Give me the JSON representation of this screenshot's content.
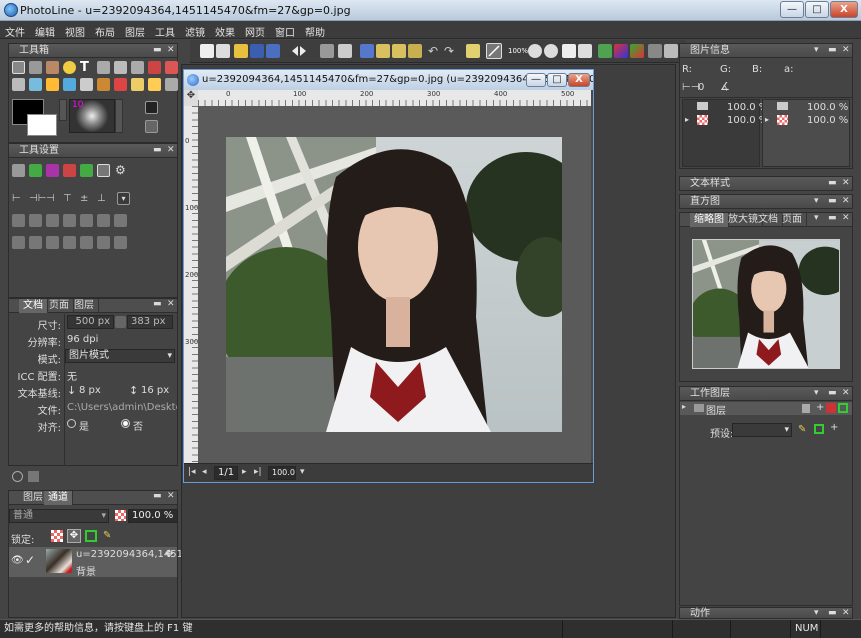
{
  "window": {
    "title": "PhotoLine - u=2392094364,1451145470&fm=27&gp=0.jpg",
    "minimize_label": "—",
    "maximize_label": "□",
    "close_label": "X"
  },
  "menu": [
    "文件",
    "编辑",
    "视图",
    "布局",
    "图层",
    "工具",
    "滤镜",
    "效果",
    "网页",
    "窗口",
    "帮助"
  ],
  "toolbar": {
    "zoom_label": "100%"
  },
  "toolbox": {
    "title": "工具箱",
    "brush_size": "10"
  },
  "tool_settings": {
    "title": "工具设置"
  },
  "doc_panel": {
    "tabs": [
      "文档",
      "页面",
      "图层"
    ],
    "size_label": "尺寸:",
    "size_w": "500 px",
    "size_h": "383 px",
    "resolution_label": "分辨率:",
    "resolution_value": "96 dpi",
    "mode_label": "模式:",
    "mode_value": "图片模式",
    "icc_label": "ICC 配置:",
    "icc_value": "无",
    "baseline_label": "文本基线:",
    "baseline_a": "8 px",
    "baseline_b": "16 px",
    "file_label": "文件:",
    "file_value": "C:\\Users\\admin\\Desktop\\dow",
    "align_label": "对齐:",
    "align_yes": "是",
    "align_no": "否"
  },
  "layers_panel": {
    "tabs": [
      "图层",
      "通道"
    ],
    "blend_mode": "普通",
    "opacity": "100.0 %",
    "lock_label": "锁定:",
    "layer_name": "u=2392094364,1451...",
    "layer_sub": "背景"
  },
  "document_window": {
    "title": "u=2392094364,1451145470&fm=27&gp=0.jpg (u=2392094364,1451145470&fm...",
    "page_field": "1/1",
    "zoom_field": "100.0 %",
    "ruler_h": [
      "0",
      "100",
      "200",
      "300",
      "400",
      "500"
    ],
    "ruler_v": [
      "0",
      "100",
      "200",
      "300"
    ]
  },
  "image_info": {
    "title": "图片信息",
    "channels": [
      "R:",
      "G:",
      "B:",
      "a:"
    ],
    "coord_value": "0",
    "rows": [
      {
        "left": "100.0 %",
        "right": "100.0 %"
      },
      {
        "left": "100.0 %",
        "right": "100.0 %"
      }
    ]
  },
  "text_style": {
    "title": "文本样式"
  },
  "histogram": {
    "title": "直方图"
  },
  "navigator": {
    "tabs": [
      "缩略图",
      "放大镜",
      "文档",
      "页面"
    ]
  },
  "work_layers": {
    "title": "工作图层",
    "layer_label": "图层",
    "preset_label": "预设:"
  },
  "actions": {
    "title": "动作"
  },
  "status": {
    "help_text": "如需更多的帮助信息，请按键盘上的 F1 键",
    "num": "NUM"
  },
  "colors": {
    "accent": "#3a7bd5",
    "panel_bg": "#444444",
    "title_bar": "#c7d6e6"
  }
}
